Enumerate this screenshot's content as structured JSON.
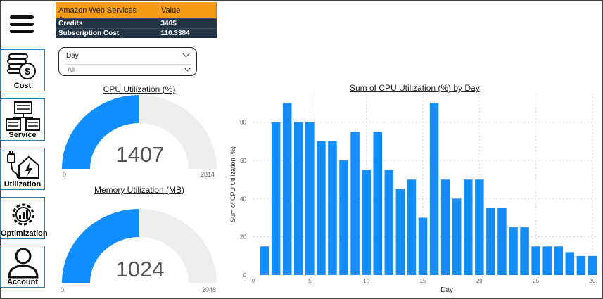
{
  "aws_table": {
    "headers": [
      "Amazon Web Services",
      "Value"
    ],
    "rows": [
      {
        "label": "Credits",
        "value": "340$"
      },
      {
        "label": "Subscription Cost",
        "value": "110.3384"
      }
    ]
  },
  "nav": {
    "items": [
      {
        "label": "Cost",
        "icon": "money-stack-icon"
      },
      {
        "label": "Service",
        "icon": "server-network-icon"
      },
      {
        "label": "Utilization",
        "icon": "plug-home-icon"
      },
      {
        "label": "Optimization",
        "icon": "gear-chart-icon"
      },
      {
        "label": "Account",
        "icon": "user-icon"
      }
    ]
  },
  "slicer": {
    "title": "Day",
    "selected": "All"
  },
  "cpu_gauge": {
    "title": "CPU Utilization (%)",
    "value": "1407",
    "min": "0",
    "max": "2814",
    "fraction": 0.5
  },
  "memory_gauge": {
    "title": "Memory Utilization (MB)",
    "value": "1024",
    "min": "0",
    "max": "2048",
    "fraction": 0.5
  },
  "colors": {
    "accent": "#118dff",
    "gauge_track": "#efeeee",
    "header_orange": "#f59d14",
    "header_navy": "#243447"
  },
  "chart_data": {
    "type": "bar",
    "title": "Sum of CPU Utilization (%) by Day",
    "xlabel": "Day",
    "ylabel": "Sum of CPU Utilization (%)",
    "x": [
      1,
      2,
      3,
      4,
      5,
      6,
      7,
      8,
      9,
      10,
      11,
      12,
      13,
      14,
      15,
      16,
      17,
      18,
      19,
      20,
      21,
      22,
      23,
      24,
      25,
      26,
      27,
      28,
      29,
      30
    ],
    "values": [
      15,
      80,
      90,
      80,
      80,
      70,
      70,
      60,
      75,
      55,
      75,
      55,
      45,
      50,
      30,
      90,
      50,
      40,
      50,
      50,
      35,
      35,
      25,
      25,
      15,
      15,
      15,
      12,
      10,
      10
    ],
    "xticks": [
      0,
      5,
      10,
      15,
      20,
      25,
      30
    ],
    "yticks": [
      0,
      20,
      40,
      60,
      80
    ],
    "xlim": [
      0,
      30.5
    ],
    "ylim": [
      0,
      95
    ],
    "grid": true
  }
}
